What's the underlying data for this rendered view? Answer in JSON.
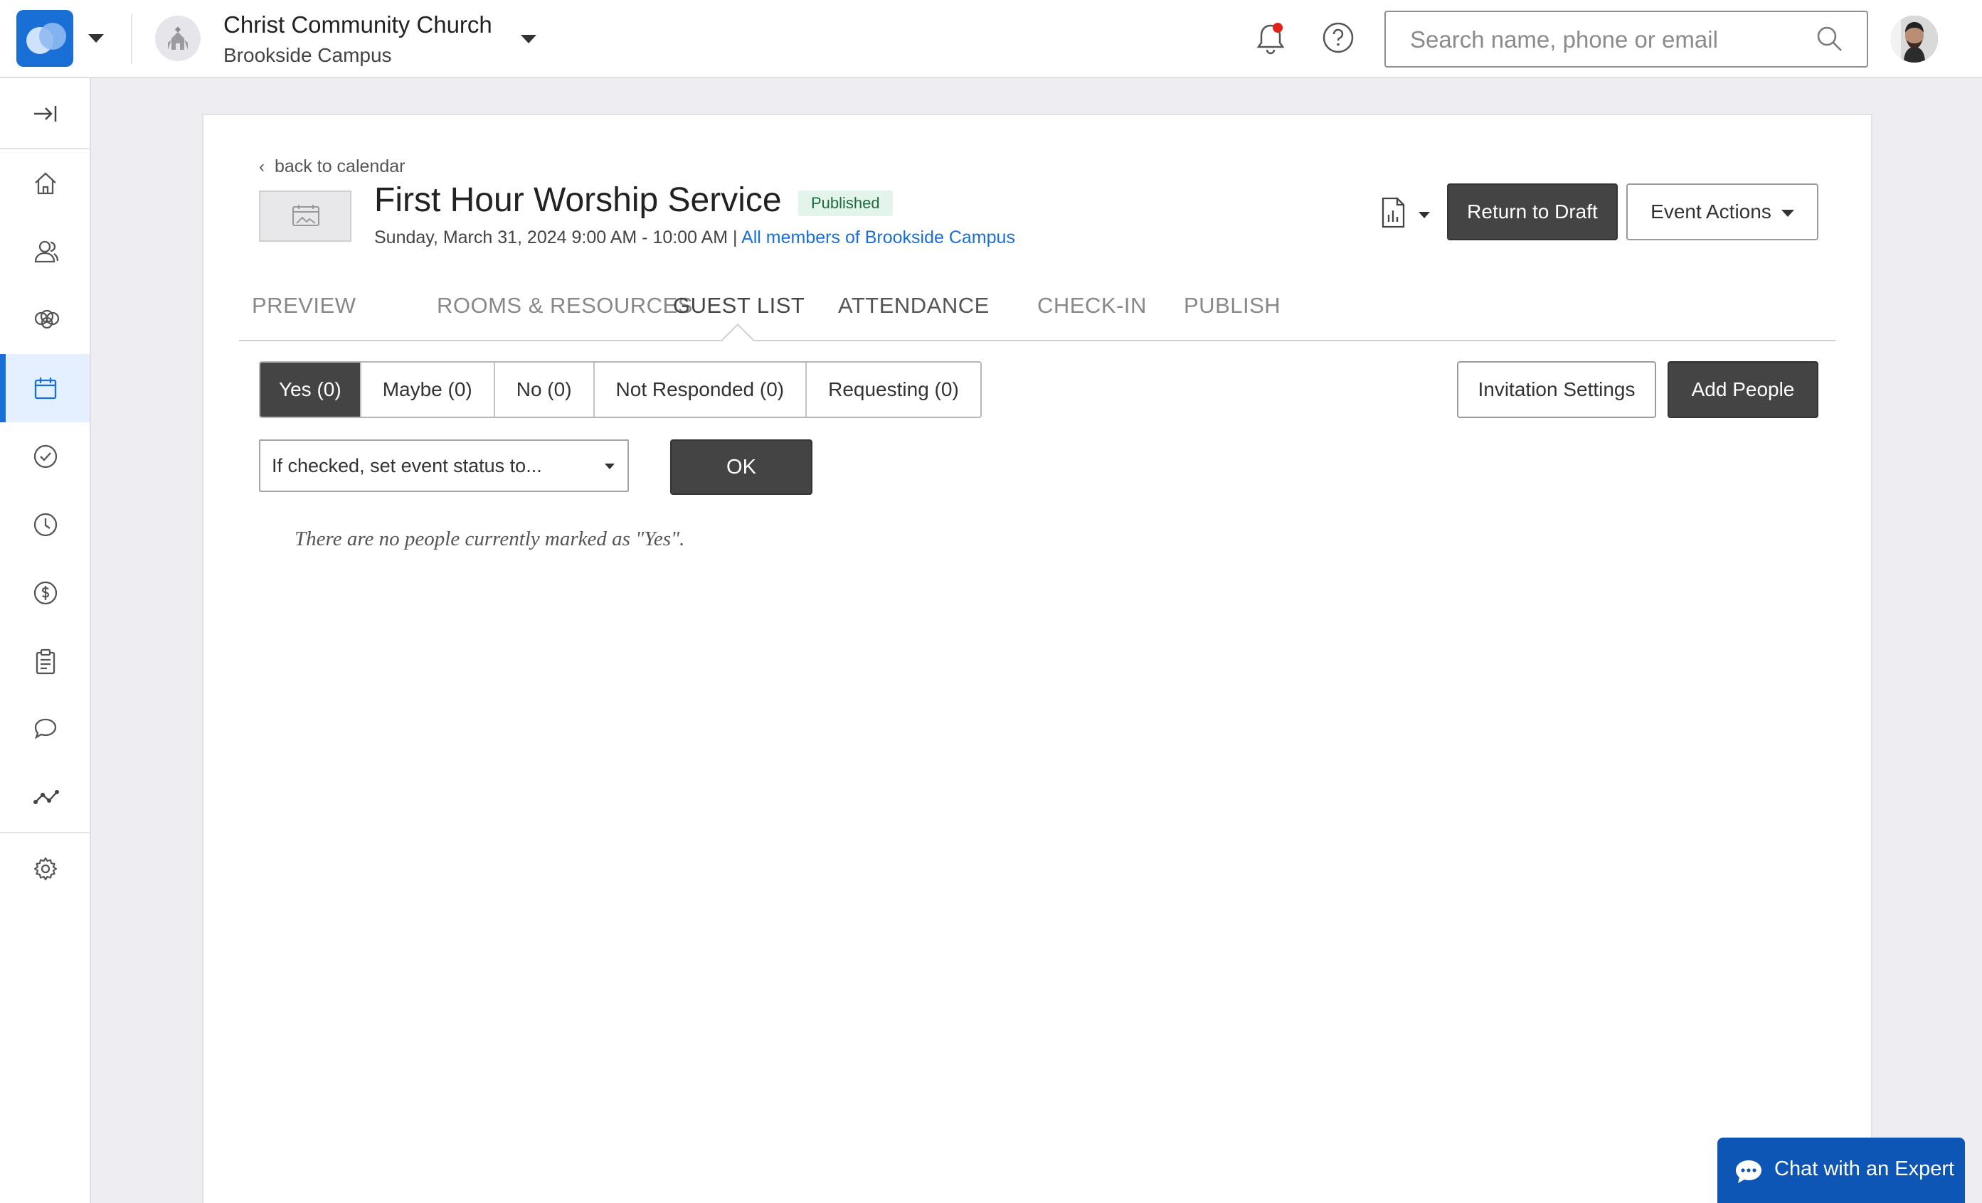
{
  "header": {
    "church_name": "Christ Community Church",
    "campus_name": "Brookside Campus",
    "search_placeholder": "Search name, phone or email",
    "notification_dot_color": "#e0241c",
    "brand_color": "#1a6fd6"
  },
  "sidebar": {
    "items": [
      {
        "icon": "collapse-icon"
      },
      {
        "icon": "home-icon"
      },
      {
        "icon": "people-icon"
      },
      {
        "icon": "groups-icon"
      },
      {
        "icon": "calendar-icon",
        "active": true
      },
      {
        "icon": "check-circle-icon"
      },
      {
        "icon": "clock-icon"
      },
      {
        "icon": "dollar-icon"
      },
      {
        "icon": "clipboard-icon"
      },
      {
        "icon": "chat-bubbles-icon"
      },
      {
        "icon": "analytics-icon"
      },
      {
        "icon": "gear-icon"
      }
    ]
  },
  "event": {
    "back_label": "back to calendar",
    "back_chevron": "‹",
    "title": "First Hour Worship Service",
    "status_badge": "Published",
    "datetime": "Sunday, March 31, 2024 9:00 AM - 10:00 AM",
    "separator": " | ",
    "audience_link": "All members of Brookside Campus"
  },
  "actions": {
    "return_to_draft": "Return to Draft",
    "event_actions": "Event Actions"
  },
  "tabs": [
    {
      "label": "PREVIEW"
    },
    {
      "label": "ROOMS & RESOURCES"
    },
    {
      "label": "GUEST LIST",
      "active": true
    },
    {
      "label": "ATTENDANCE"
    },
    {
      "label": "CHECK-IN"
    },
    {
      "label": "PUBLISH"
    }
  ],
  "guest_filters": [
    {
      "label": "Yes (0)",
      "active": true
    },
    {
      "label": "Maybe (0)"
    },
    {
      "label": "No (0)"
    },
    {
      "label": "Not Responded (0)"
    },
    {
      "label": "Requesting (0)"
    }
  ],
  "guest_actions": {
    "invitation_settings": "Invitation Settings",
    "add_people": "Add People"
  },
  "status_control": {
    "selected": "If checked, set event status to...",
    "ok_label": "OK"
  },
  "empty_message": "There are no people currently marked as \"Yes\".",
  "chat": {
    "label": "Chat with an Expert"
  }
}
